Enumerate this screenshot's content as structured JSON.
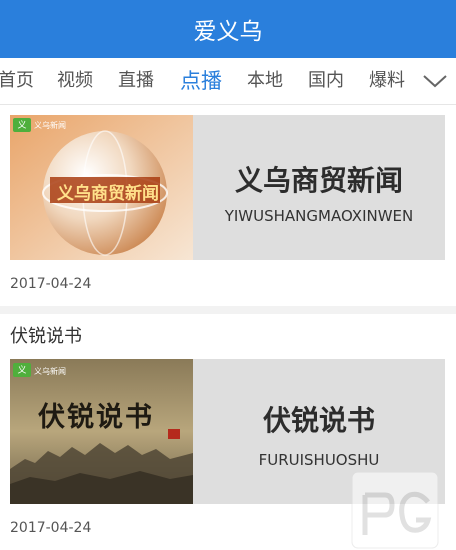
{
  "header": {
    "title": "爱义乌"
  },
  "tabs": [
    {
      "label": "首页"
    },
    {
      "label": "视频"
    },
    {
      "label": "直播"
    },
    {
      "label": "点播",
      "active": true
    },
    {
      "label": "本地"
    },
    {
      "label": "国内"
    },
    {
      "label": "爆料"
    }
  ],
  "expand_icon": "chevron-down-icon",
  "accent_color": "#2a7fdc",
  "items": [
    {
      "title": "",
      "card_title": "义乌商贸新闻",
      "card_pinyin": "YIWUSHANGMAOXINWEN",
      "thumb_text": "义乌商贸新闻",
      "thumb_logo": "义乌新闻",
      "date": "2017-04-24"
    },
    {
      "title": "伏锐说书",
      "card_title": "伏锐说书",
      "card_pinyin": "FURUISHUOSHU",
      "thumb_text": "伏锐说书",
      "thumb_logo": "义乌新闻",
      "date": "2017-04-24"
    }
  ]
}
